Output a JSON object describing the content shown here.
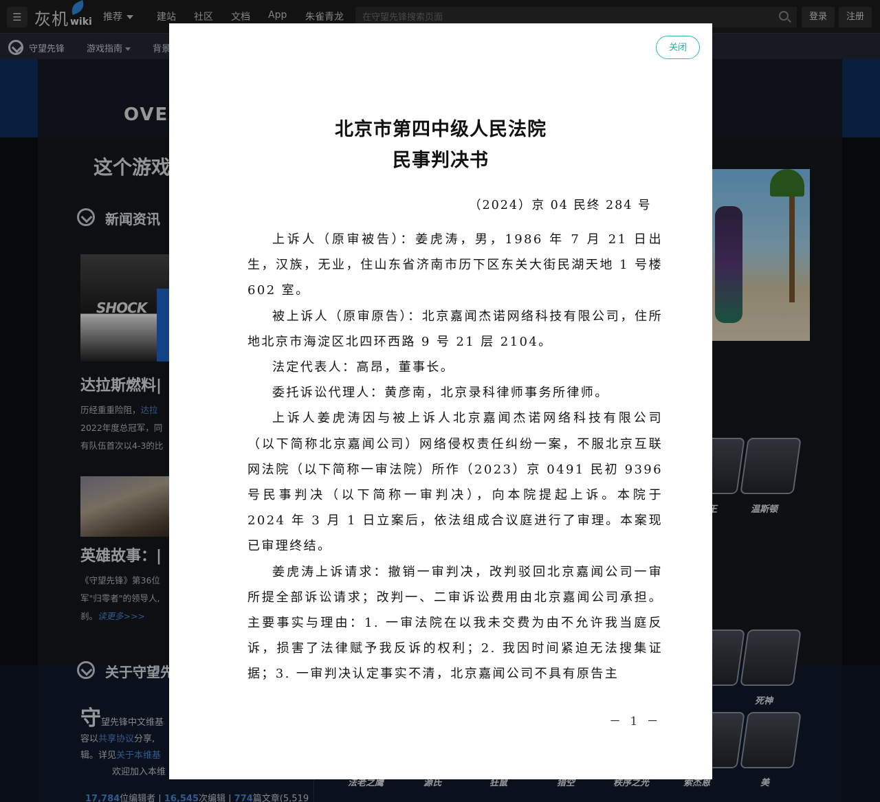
{
  "topbar": {
    "logo_text": "灰机",
    "logo_suffix": "wiki",
    "nav": [
      "推荐",
      "建站",
      "社区",
      "文档",
      "App",
      "朱雀青龙"
    ],
    "search_placeholder": "在守望先锋搜索页面",
    "login": "登录",
    "register": "注册"
  },
  "subnav": {
    "site_name": "守望先锋",
    "items": [
      "游戏指南",
      "背景"
    ]
  },
  "background": {
    "ovw_logo": "OVE",
    "game_heading": "这个游戏",
    "news_heading": "新闻资讯",
    "shock_label": "SHOCK",
    "article1_title": "达拉斯燃料|",
    "article1_lines": [
      "历经重重险阻，",
      "2022年度总冠军，同",
      "有队伍首次以4-3的比"
    ],
    "article1_link": "达拉",
    "article2_title": "英雄故事：|",
    "article2_lines": [
      "《守望先锋》第36位",
      "军\"归零者\"的领导人,",
      "刹。"
    ],
    "read_more": "读更多>>>",
    "about_heading": "关于守望先",
    "wiki_big_char": "守",
    "wiki_line1": "望先锋中文维基",
    "wiki_line2_a": "容以",
    "wiki_line2_link": "共享协议",
    "wiki_line2_b": "分享,",
    "wiki_line3_a": "辑。详见",
    "wiki_line3_link": "关于本维基",
    "wiki_line4": "欢迎加入本维",
    "stats": {
      "editors": "17,784",
      "editors_label": "位编辑者 | ",
      "edits": "16,545",
      "edits_label": "次编辑 | ",
      "articles": "774",
      "articles_label": "篇文章(5,519"
    },
    "heroes": [
      "王",
      "温斯顿",
      "死神",
      "美",
      "法老之鹰",
      "源氏",
      "狂鼠",
      "猎空",
      "秩序之光",
      "索杰恩"
    ]
  },
  "modal": {
    "close_label": "关闭",
    "title_line1": "北京市第四中级人民法院",
    "title_line2": "民事判决书",
    "case_number": "（2024）京 04 民终 284 号",
    "paragraphs": [
      "上诉人（原审被告）：姜虎涛，男，1986 年 7 月 21 日出生，汉族，无业，住山东省济南市历下区东关大街民湖天地 1 号楼 602 室。",
      "被上诉人（原审原告）：北京嘉闻杰诺网络科技有限公司，住所地北京市海淀区北四环西路 9 号 21 层 2104。",
      "法定代表人：高昂，董事长。",
      "委托诉讼代理人：黄彦南，北京录科律师事务所律师。",
      "上诉人姜虎涛因与被上诉人北京嘉闻杰诺网络科技有限公司（以下简称北京嘉闻公司）网络侵权责任纠纷一案，不服北京互联网法院（以下简称一审法院）所作（2023）京 0491 民初 9396 号民事判决（以下简称一审判决），向本院提起上诉。本院于 2024 年 3 月 1 日立案后，依法组成合议庭进行了审理。本案现已审理终结。",
      "姜虎涛上诉请求：撤销一审判决，改判驳回北京嘉闻公司一审所提全部诉讼请求；改判一、二审诉讼费用由北京嘉闻公司承担。主要事实与理由：1. 一审法院在以我未交费为由不允许我当庭反诉，损害了法律赋予我反诉的权利；2. 我因时间紧迫无法搜集证据；3. 一审判决认定事实不清，北京嘉闻公司不具有原告主"
    ],
    "page_number": "－ 1 －"
  }
}
